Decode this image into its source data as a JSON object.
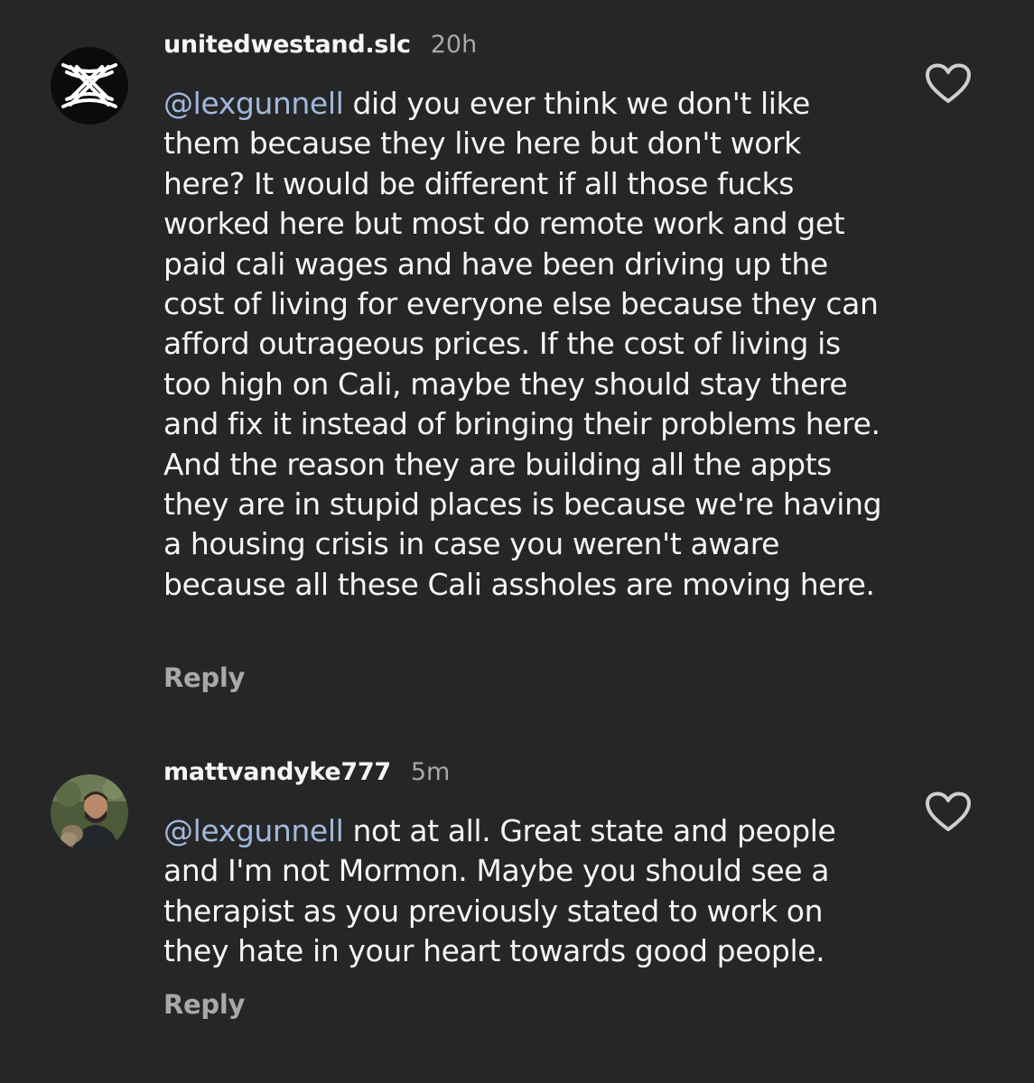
{
  "comments": [
    {
      "username": "unitedwestand.slc",
      "time": "20h",
      "mention": "@lexgunnell",
      "text": " did you ever think we don't like them because they live here but don't work here? It would be different if all those fucks worked here but most do remote work and get paid cali wages and have been driving up the cost of living for everyone else because they can afford outrageous prices. If the cost of living is too high on Cali, maybe they should stay there and fix it instead of bringing their problems here. And the reason they are building all the appts they are in stupid places is because we're having a housing crisis in case you weren't aware because all these Cali assholes are moving here.",
      "reply_label": "Reply"
    },
    {
      "username": "mattvandyke777",
      "time": "5m",
      "mention": "@lexgunnell",
      "text": " not at all. Great state and people and I'm not Mormon. Maybe you should see a therapist as you previously stated to work on they hate in your heart towards good people.",
      "reply_label": "Reply"
    }
  ]
}
